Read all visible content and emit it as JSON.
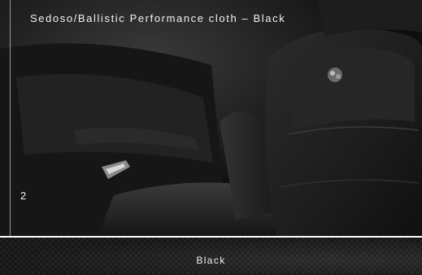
{
  "photo": {
    "caption": "Sedoso/Ballistic Performance cloth – Black",
    "page_marker": "2"
  },
  "swatch": {
    "label": "Black"
  }
}
